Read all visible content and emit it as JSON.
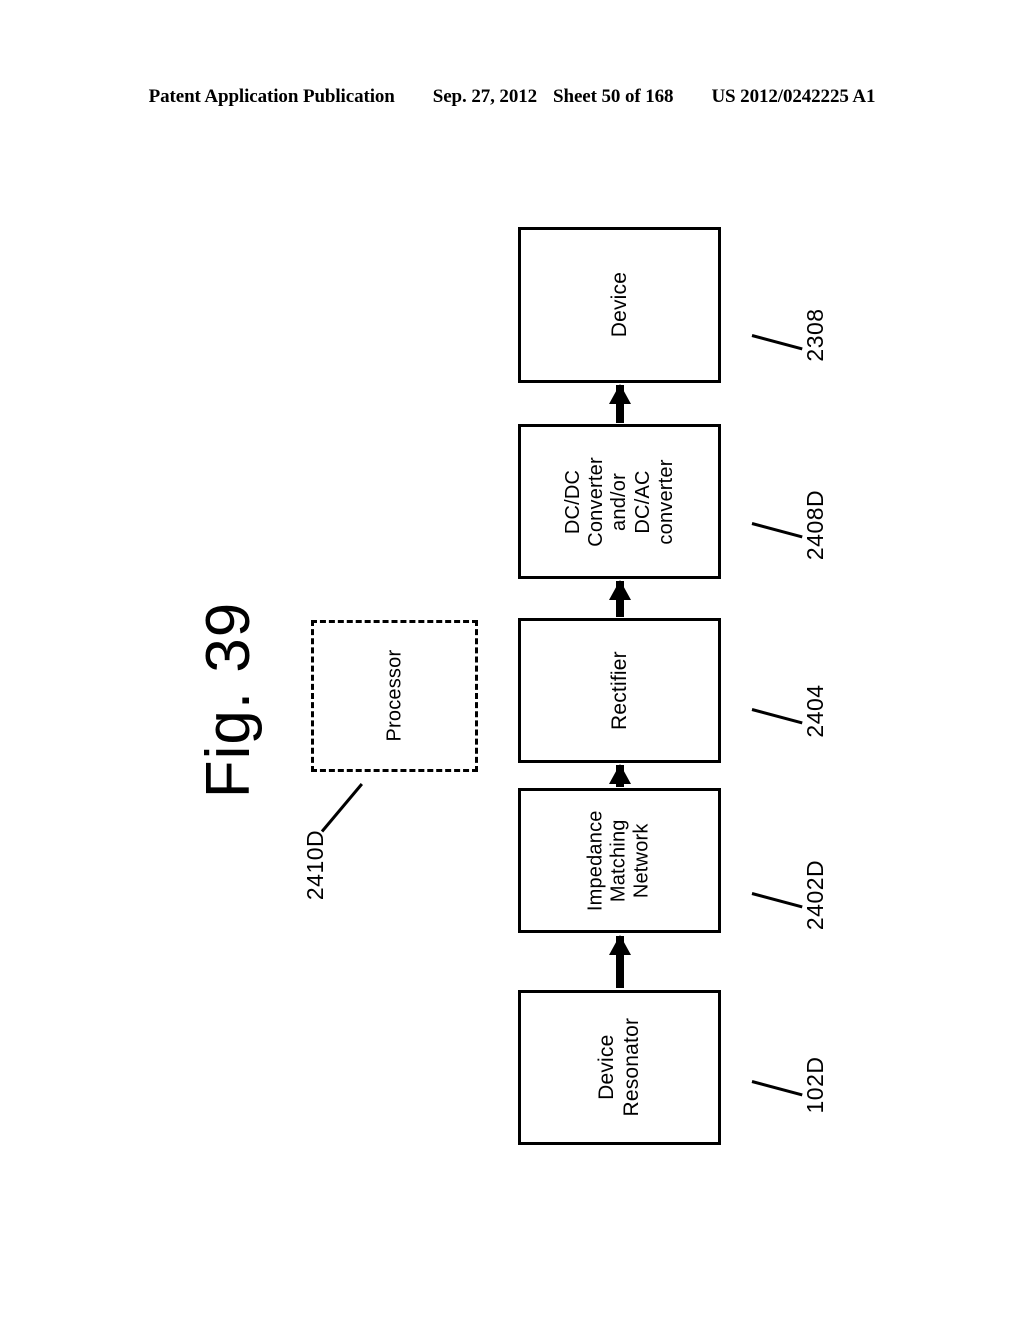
{
  "header": {
    "publication": "Patent Application Publication",
    "date": "Sep. 27, 2012",
    "sheet": "Sheet 50 of 168",
    "number": "US 2012/0242225 A1"
  },
  "figure": {
    "title": "Fig. 39"
  },
  "diagram": {
    "type": "block-flow-diagram",
    "orientation": "rotated-90-ccw",
    "boxes": [
      {
        "id": "device",
        "label": "Device",
        "ref": "2308",
        "style": "solid"
      },
      {
        "id": "converter",
        "label": "DC/DC\nConverter\nand/or\nDC/AC\nconverter",
        "ref": "2408D",
        "style": "solid"
      },
      {
        "id": "rectifier",
        "label": "Rectifier",
        "ref": "2404",
        "style": "solid"
      },
      {
        "id": "impedance",
        "label": "Impedance\nMatching\nNetwork",
        "ref": "2402D",
        "style": "solid"
      },
      {
        "id": "resonator",
        "label": "Device\nResonator",
        "ref": "102D",
        "style": "solid"
      },
      {
        "id": "processor",
        "label": "Processor",
        "ref": "2410D",
        "style": "dashed"
      }
    ],
    "refs": {
      "device": "2308",
      "converter": "2408D",
      "rectifier": "2404",
      "impedance": "2402D",
      "resonator": "102D",
      "processor": "2410D"
    },
    "arrows": [
      {
        "from": "resonator",
        "to": "impedance"
      },
      {
        "from": "impedance",
        "to": "rectifier"
      },
      {
        "from": "rectifier",
        "to": "converter"
      },
      {
        "from": "converter",
        "to": "device"
      }
    ]
  },
  "colors": {
    "ink": "#000000",
    "paper": "#ffffff"
  }
}
